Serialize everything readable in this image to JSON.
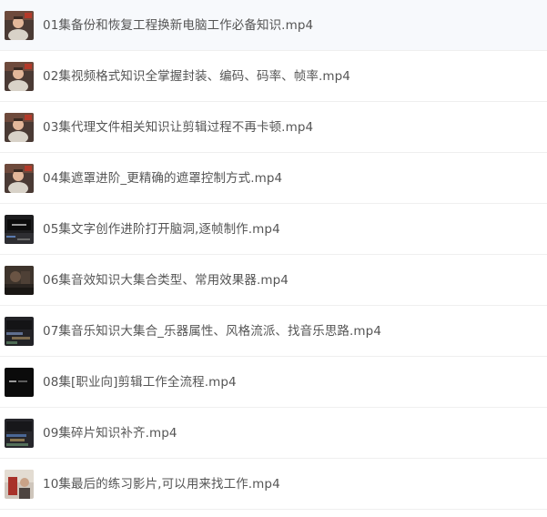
{
  "files": [
    {
      "name": "01集备份和恢复工程换新电脑工作必备知识.mp4",
      "icon": "person-thumbnail-icon"
    },
    {
      "name": "02集视频格式知识全掌握封装、编码、码率、帧率.mp4",
      "icon": "person-thumbnail-icon"
    },
    {
      "name": "03集代理文件相关知识让剪辑过程不再卡顿.mp4",
      "icon": "person-thumbnail-icon"
    },
    {
      "name": "04集遮罩进阶_更精确的遮罩控制方式.mp4",
      "icon": "person-thumbnail-icon"
    },
    {
      "name": "05集文字创作进阶打开脑洞,逐帧制作.mp4",
      "icon": "editor-screen-thumbnail-icon"
    },
    {
      "name": "06集音效知识大集合类型、常用效果器.mp4",
      "icon": "dim-scene-thumbnail-icon"
    },
    {
      "name": "07集音乐知识大集合_乐器属性、风格流派、找音乐思路.mp4",
      "icon": "timeline-thumbnail-icon"
    },
    {
      "name": "08集[职业向]剪辑工作全流程.mp4",
      "icon": "dark-screen-thumbnail-icon"
    },
    {
      "name": "09集碎片知识补齐.mp4",
      "icon": "timeline-thumbnail-icon"
    },
    {
      "name": "10集最后的练习影片,可以用来找工作.mp4",
      "icon": "red-scene-thumbnail-icon"
    }
  ]
}
